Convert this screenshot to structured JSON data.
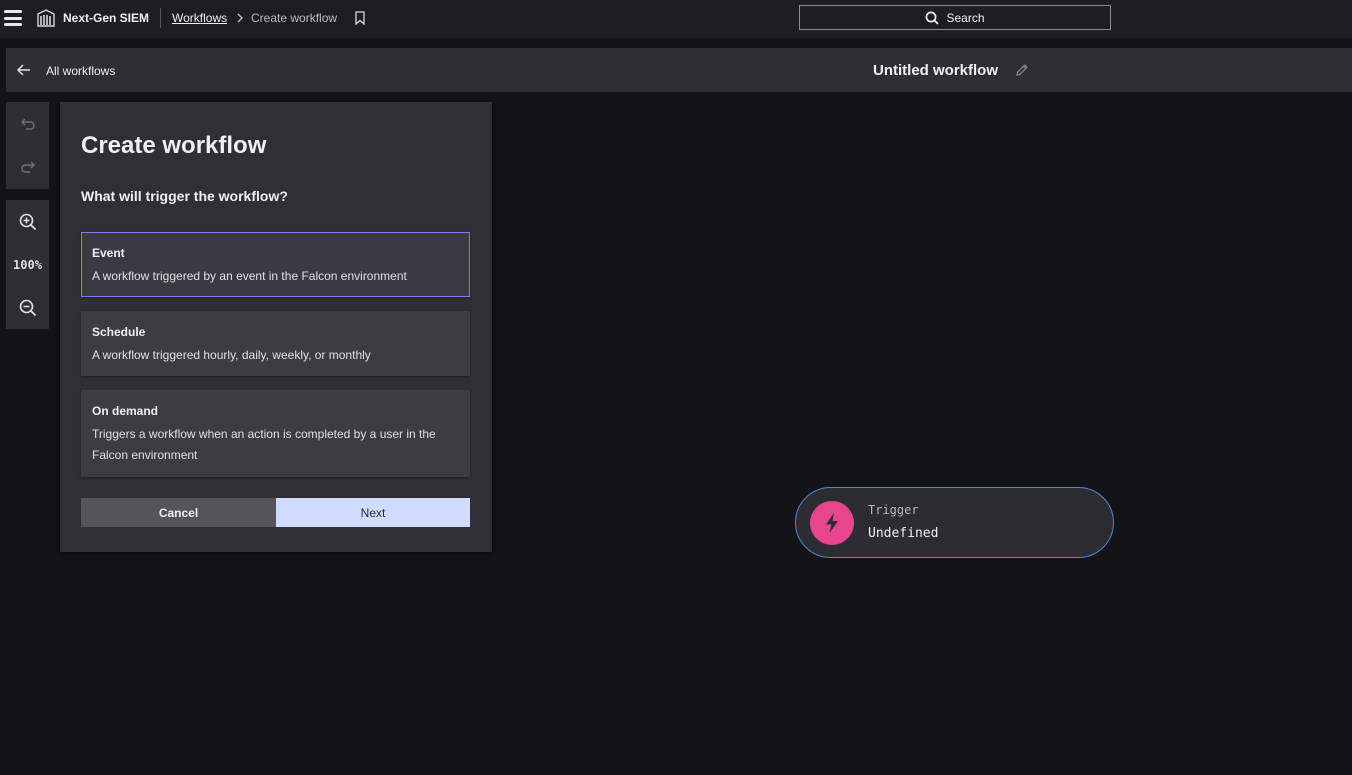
{
  "topbar": {
    "app_name": "Next-Gen SIEM",
    "breadcrumb_link": "Workflows",
    "breadcrumb_current": "Create workflow",
    "search_label": "Search"
  },
  "header": {
    "back_label": "All workflows",
    "workflow_title": "Untitled workflow"
  },
  "toolbar": {
    "zoom_level": "100%"
  },
  "panel": {
    "title": "Create workflow",
    "question": "What will trigger the workflow?",
    "options": [
      {
        "title": "Event",
        "description": "A workflow triggered by an event in the Falcon environment",
        "selected": true
      },
      {
        "title": "Schedule",
        "description": "A workflow triggered hourly, daily, weekly, or monthly",
        "selected": false
      },
      {
        "title": "On demand",
        "description": "Triggers a workflow when an action is completed by a user in the Falcon environment",
        "selected": false
      }
    ],
    "cancel_label": "Cancel",
    "next_label": "Next"
  },
  "trigger_node": {
    "label": "Trigger",
    "value": "Undefined"
  },
  "colors": {
    "accent_selected": "#7f7fe8",
    "next_button": "#cfdcff",
    "trigger_icon": "#e8458f",
    "node_border": "#4b8ad8"
  }
}
